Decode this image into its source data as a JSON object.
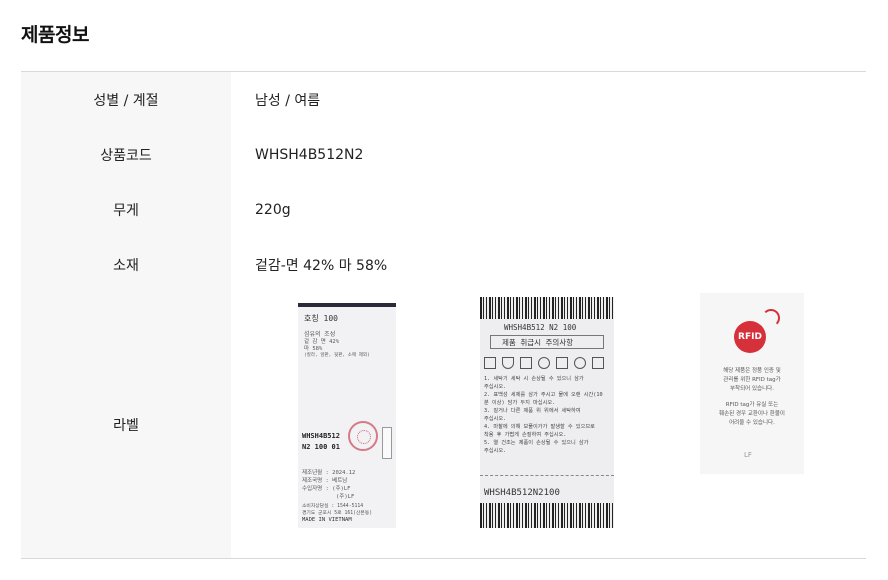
{
  "section_title": "제품정보",
  "rows": [
    {
      "label": "성별 / 계절",
      "value": "남성 / 여름"
    },
    {
      "label": "상품코드",
      "value": "WHSH4B512N2"
    },
    {
      "label": "무게",
      "value": "220g"
    },
    {
      "label": "소재",
      "value": "겉감-면 42% 마 58%"
    }
  ],
  "label_row": {
    "label": "라벨"
  },
  "label_images": {
    "care_label_1": {
      "size": "호칭    100",
      "fiber_title": "섬유의 조성",
      "fiber_line1": "겉 감     면     42%",
      "fiber_line2": "          마     58%",
      "fiber_note": "(칼라, 앞판, 뒷판, 소매 제외)",
      "code_line1": "WHSH4B512",
      "code_line2": "N2  100  01",
      "made_date": "제조년월 : 2024.12",
      "made_country": "제조국명 : 베트남",
      "importer": "수입자명 : (주)LF",
      "importer2": "(주)LF",
      "cs_phone": "소비자상담실 : 1544-5114",
      "address": "경기도 군포시 5로 161(산본동)",
      "made_in": "MADE IN VIETNAM"
    },
    "care_label_2": {
      "code": "WHSH4B512 N2 100",
      "care_title": "제품 취급시 주의사항",
      "line1": "1. 세탁기 세탁 시 손상될 수 있으니 삼가",
      "line2": "   주십시오.",
      "line3": "2. 표백성 세제를 삼가 주시고 물에 오랜 시간(10",
      "line4": "   분 이상) 담가 두지 마십시오.",
      "line5": "3. 짙거나 다른 제품 위 위에서 세탁하여",
      "line6": "   주십시오.",
      "line7": "4. 마찰에 의해 보풀이가가 발생할 수 있으므로",
      "line8": "   착용 후 가볍게 손질하여 주십시오.",
      "line9": "5. 열 건조는 제품이 손상될 수 있으니 삼가",
      "line10": "   주십시오.",
      "bottom_code": "WHSH4B512N2100"
    },
    "rfid_tag": {
      "logo_text": "RFID",
      "line1": "해당 제품은 정품 인증 및",
      "line2": "관리를 위한 RFID tag가",
      "line3": "부착되어 있습니다.",
      "line4": "RFID tag가 유실 또는",
      "line5": "훼손된 경우 교환이나 환불이",
      "line6": "어려울 수 있습니다.",
      "brand": "LF"
    }
  }
}
